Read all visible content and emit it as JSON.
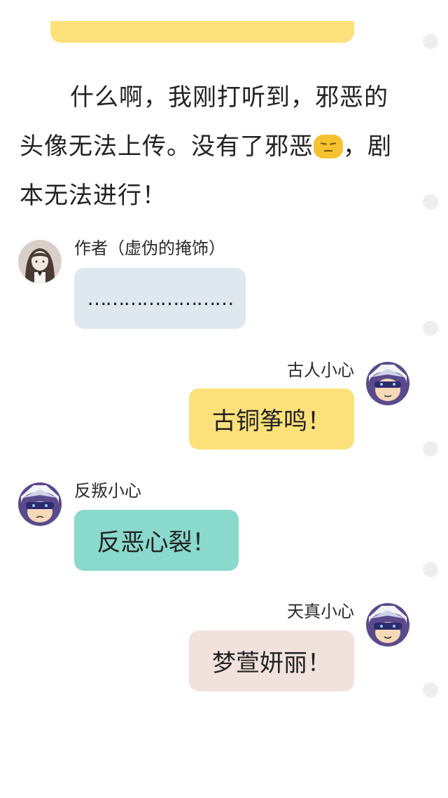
{
  "narration": {
    "line1": "什么啊，我刚打听到，邪恶的头像无法上传。没有了邪恶",
    "line2": "，剧本无法进行！",
    "emoji_icon": "unamused-face-emoji"
  },
  "messages": [
    {
      "speaker": "作者（虚伪的掩饰）",
      "text": "……………………",
      "side": "left",
      "bubble_color": "#dfe8ee",
      "avatar": "girl-avatar"
    },
    {
      "speaker": "古人小心",
      "text": "古铜筝鸣！",
      "side": "right",
      "bubble_color": "#fce17a",
      "avatar": "masked-hero-avatar"
    },
    {
      "speaker": "反叛小心",
      "text": "反恶心裂！",
      "side": "left",
      "bubble_color": "#89d9cc",
      "avatar": "masked-hero-avatar"
    },
    {
      "speaker": "天真小心",
      "text": "梦萱妍丽！",
      "side": "right",
      "bubble_color": "#f2e2de",
      "avatar": "masked-hero-avatar"
    }
  ]
}
